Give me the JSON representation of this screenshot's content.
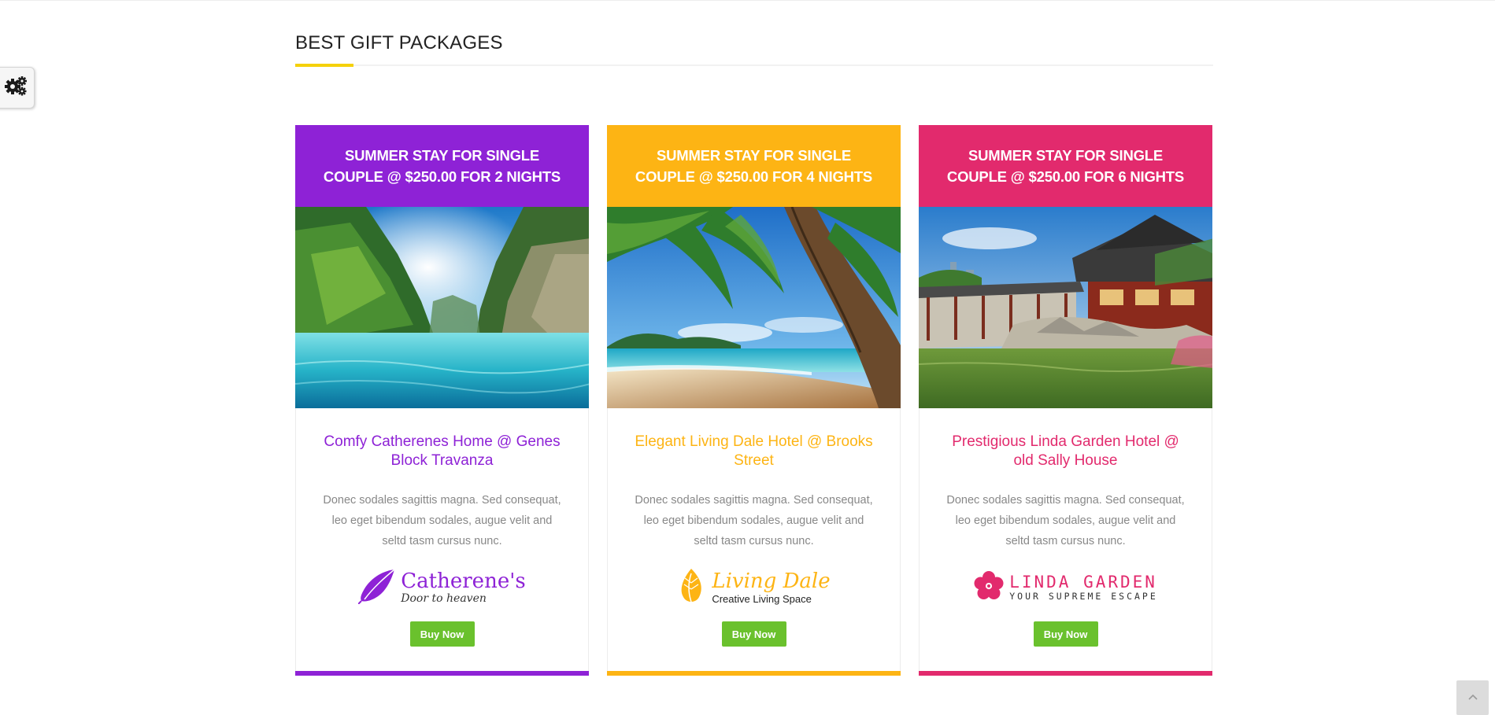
{
  "section": {
    "title": "BEST GIFT PACKAGES"
  },
  "colors": {
    "accent_yellow": "#f5d10a",
    "button_green": "#6ac12d"
  },
  "cards": [
    {
      "header": "SUMMER STAY FOR SINGLE COUPLE @ $250.00 FOR 2 NIGHTS",
      "title": "Comfy Catherenes Home @ Genes Block Travanza",
      "description": "Donec sodales sagittis magna. Sed consequat, leo eget bibendum sodales, augue velit and seltd tasm cursus nunc.",
      "brand_name": "Catherene's",
      "brand_tagline": "Door to heaven",
      "button": "Buy Now",
      "color": "#8e22d6",
      "image": "lagoon-cliffs"
    },
    {
      "header": "SUMMER STAY FOR SINGLE COUPLE @ $250.00 FOR 4 NIGHTS",
      "title": "Elegant Living Dale Hotel @ Brooks Street",
      "description": "Donec sodales sagittis magna. Sed consequat, leo eget bibendum sodales, augue velit and seltd tasm cursus nunc.",
      "brand_name": "Living Dale",
      "brand_tagline": "Creative Living Space",
      "button": "Buy Now",
      "color": "#fdb414",
      "image": "palm-beach"
    },
    {
      "header": "SUMMER STAY FOR SINGLE COUPLE @ $250.00 FOR 6 NIGHTS",
      "title": "Prestigious Linda Garden Hotel @ old Sally House",
      "description": "Donec sodales sagittis magna. Sed consequat, leo eget bibendum sodales, augue velit and seltd tasm cursus nunc.",
      "brand_name": "LINDA GARDEN",
      "brand_tagline": "YOUR SUPREME ESCAPE",
      "button": "Buy Now",
      "color": "#e22a6d",
      "image": "chinese-garden"
    }
  ],
  "icons": {
    "settings": "gears-icon",
    "scroll_top": "chevron-up-icon"
  }
}
